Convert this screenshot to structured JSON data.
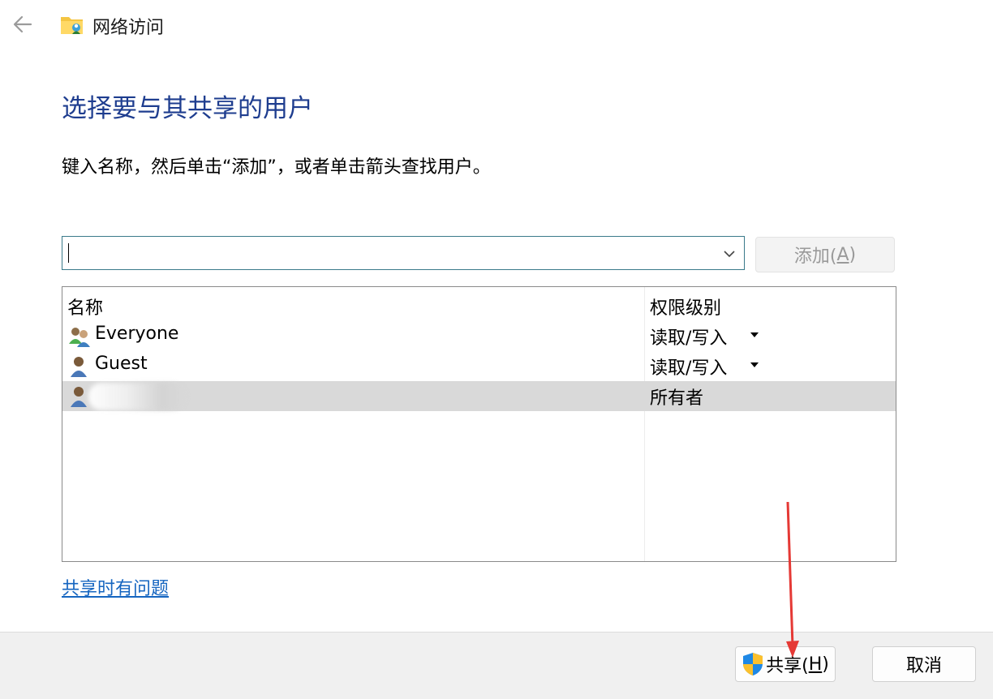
{
  "window": {
    "title": "网络访问",
    "icons": {
      "back": "back-arrow-icon",
      "app": "network-folder-icon"
    }
  },
  "heading": "选择要与其共享的用户",
  "instruction": "键入名称，然后单击“添加”，或者单击箭头查找用户。",
  "name_input": {
    "value": "",
    "placeholder": ""
  },
  "add_button": {
    "label_pre": "添加(",
    "mnemonic": "A",
    "label_post": ")",
    "enabled": false
  },
  "table": {
    "columns": [
      "名称",
      "权限级别"
    ],
    "rows": [
      {
        "name": "Everyone",
        "permission": "读取/写入",
        "icon": "user-group-icon",
        "has_dropdown": true,
        "selected": false
      },
      {
        "name": "Guest",
        "permission": "读取/写入",
        "icon": "user-icon",
        "has_dropdown": true,
        "selected": false
      },
      {
        "name": "",
        "permission": "所有者",
        "icon": "user-icon",
        "has_dropdown": false,
        "selected": true
      }
    ]
  },
  "help_link": "共享时有问题",
  "share_button": {
    "label_pre": "共享(",
    "mnemonic": "H",
    "label_post": ")",
    "icon": "uac-shield-icon"
  },
  "cancel_button": {
    "label": "取消"
  },
  "colors": {
    "heading": "#1e3d8f",
    "link": "#1565c0",
    "selected_row": "#d9d9d9",
    "annotation_arrow": "#e53935"
  }
}
